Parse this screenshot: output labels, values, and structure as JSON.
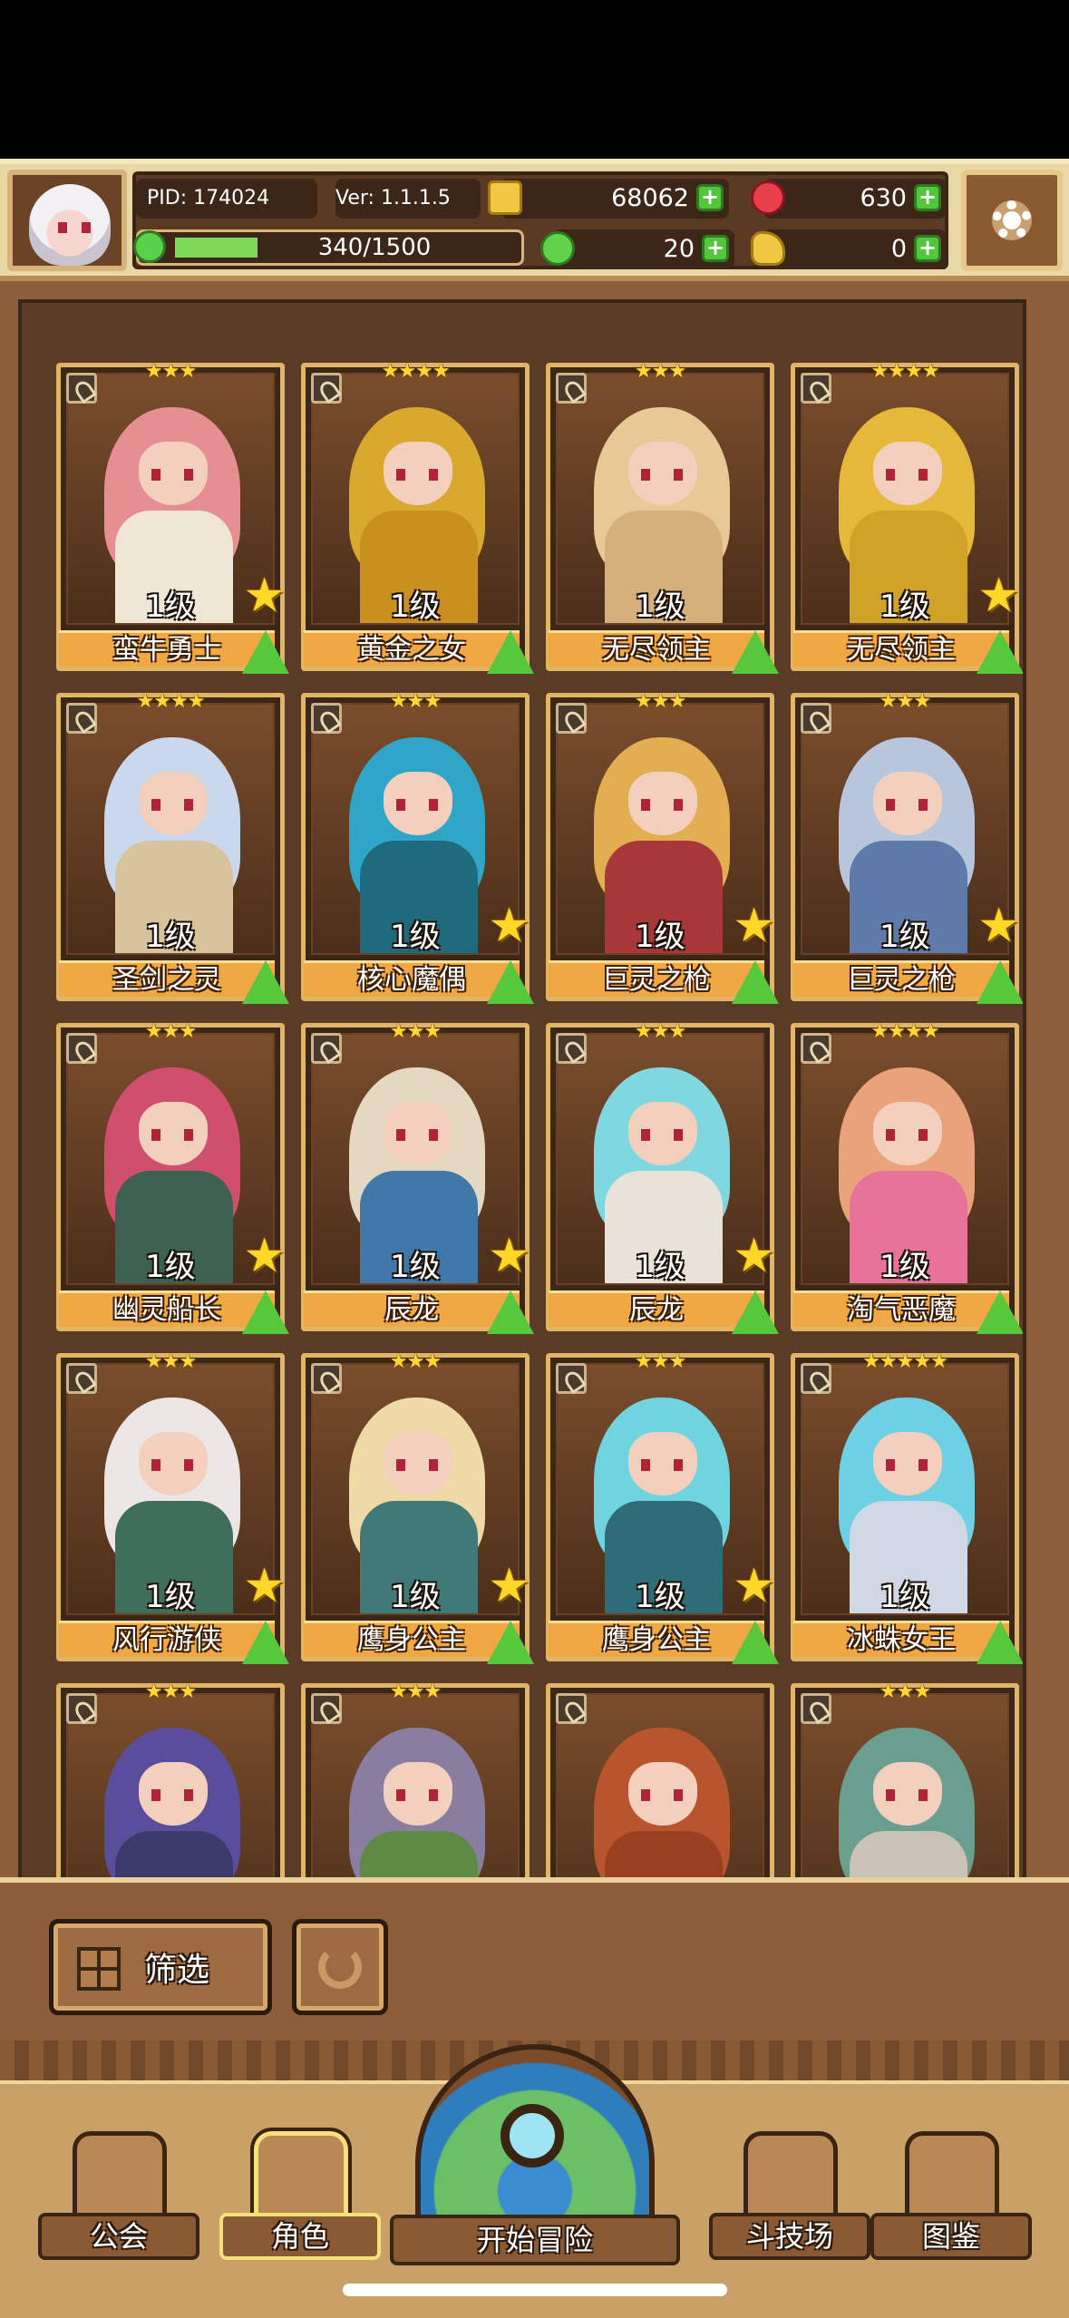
{
  "header": {
    "pid": "PID: 174024",
    "version": "Ver: 1.1.1.5",
    "xp": "340/1500",
    "xp_fraction": 0.227,
    "gold": "68062",
    "gems": "630",
    "clover": "20",
    "hand": "0",
    "plus_label": "+",
    "icons": [
      "settings-gear-icon",
      "gold-coin-icon",
      "red-gem-icon",
      "clover-icon",
      "hand-icon",
      "xp-icon"
    ]
  },
  "cards": [
    {
      "name": "蛮牛勇士",
      "level": "1级",
      "stars": "★★★",
      "favorite": true,
      "hair": "#e58f93",
      "body": "#efe6d6"
    },
    {
      "name": "黄金之女",
      "level": "1级",
      "stars": "★★★★",
      "favorite": false,
      "hair": "#d9a92e",
      "body": "#c98f1f"
    },
    {
      "name": "无尽领主",
      "level": "1级",
      "stars": "★★★",
      "favorite": false,
      "hair": "#e8c894",
      "body": "#d6b07a"
    },
    {
      "name": "无尽领主",
      "level": "1级",
      "stars": "★★★★",
      "favorite": true,
      "hair": "#e6b83a",
      "body": "#d0a227"
    },
    {
      "name": "圣剑之灵",
      "level": "1级",
      "stars": "★★★★",
      "favorite": false,
      "hair": "#c9d8ec",
      "body": "#d8c49c"
    },
    {
      "name": "核心魔偶",
      "level": "1级",
      "stars": "★★★",
      "favorite": true,
      "hair": "#2fa6c8",
      "body": "#1f6a7c"
    },
    {
      "name": "巨灵之枪",
      "level": "1级",
      "stars": "★★★",
      "favorite": true,
      "hair": "#e3ad52",
      "body": "#a8373a"
    },
    {
      "name": "巨灵之枪",
      "level": "1级",
      "stars": "★★★",
      "favorite": true,
      "hair": "#b7c6dd",
      "body": "#5e7aa8"
    },
    {
      "name": "幽灵船长",
      "level": "1级",
      "stars": "★★★",
      "favorite": true,
      "hair": "#cf4f6d",
      "body": "#3d6150"
    },
    {
      "name": "辰龙",
      "level": "1级",
      "stars": "★★★",
      "favorite": true,
      "hair": "#e4d8c2",
      "body": "#3f78a9"
    },
    {
      "name": "辰龙",
      "level": "1级",
      "stars": "★★★",
      "favorite": true,
      "hair": "#7fd8df",
      "body": "#e9e2d8"
    },
    {
      "name": "淘气恶魔",
      "level": "1级",
      "stars": "★★★★",
      "favorite": false,
      "hair": "#e9a27a",
      "body": "#e8739a"
    },
    {
      "name": "风行游侠",
      "level": "1级",
      "stars": "★★★",
      "favorite": true,
      "hair": "#ede6e6",
      "body": "#3f6e5d"
    },
    {
      "name": "鹰身公主",
      "level": "1级",
      "stars": "★★★",
      "favorite": true,
      "hair": "#efd9a6",
      "body": "#3f7a78"
    },
    {
      "name": "鹰身公主",
      "level": "1级",
      "stars": "★★★",
      "favorite": true,
      "hair": "#6fd3e0",
      "body": "#2e6c78"
    },
    {
      "name": "冰蛛女王",
      "level": "1级",
      "stars": "★★★★★",
      "favorite": false,
      "hair": "#6ed0e4",
      "body": "#cfd8e4"
    },
    {
      "name": "",
      "level": "",
      "stars": "★★★",
      "favorite": false,
      "hair": "#5a4e9c",
      "body": "#3c3a6a"
    },
    {
      "name": "",
      "level": "",
      "stars": "★★★",
      "favorite": false,
      "hair": "#8a7ea0",
      "body": "#5e8a44"
    },
    {
      "name": "",
      "level": "",
      "stars": "",
      "favorite": false,
      "hair": "#b8552e",
      "body": "#9a3f22"
    },
    {
      "name": "",
      "level": "",
      "stars": "★★★",
      "favorite": false,
      "hair": "#6a9e8e",
      "body": "#c9c3b6"
    }
  ],
  "filter": {
    "label": "筛选"
  },
  "nav": {
    "guild": "公会",
    "roles": "角色",
    "adventure": "开始冒险",
    "arena": "斗技场",
    "codex": "图鉴"
  }
}
